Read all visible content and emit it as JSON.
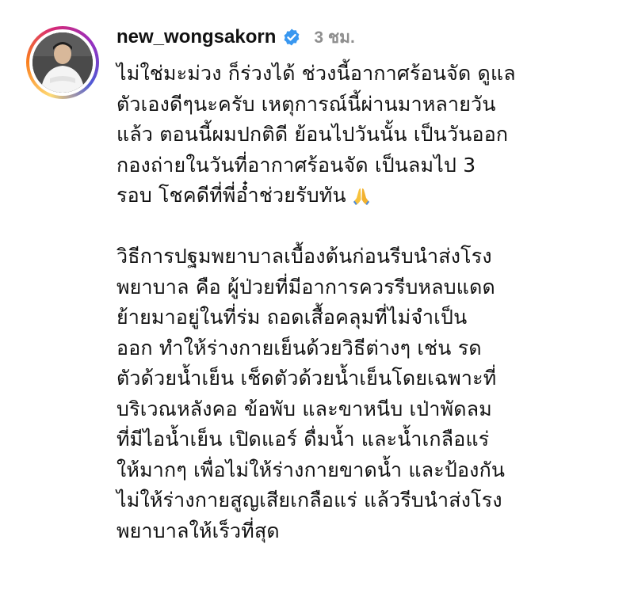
{
  "post": {
    "username": "new_wongsakorn",
    "time_ago": "3 ชม.",
    "avatar_icon": "profile-photo",
    "verified_icon": "verified-badge-icon",
    "paragraph1": [
      "ไม่ใช่มะม่วง ก็ร่วงได้ ช่วงนี้อากาศร้อนจัด ดูแล",
      "ตัวเองดีๆนะครับ เหตุการณ์นี้ผ่านมาหลายวัน",
      "แล้ว ตอนนี้ผมปกติดี ย้อนไปวันนั้น เป็นวันออก",
      "กองถ่ายในวันที่อากาศร้อนจัด เป็นลมไป 3",
      "รอบ โชคดีที่พี่อ๋ำช่วยรับทัน"
    ],
    "paragraph2": [
      "วิธีการปฐมพยาบาลเบื้องต้นก่อนรีบนำส่งโรง",
      "พยาบาล คือ ผู้ป่วยที่มีอาการควรรีบหลบแดด",
      "ย้ายมาอยู่ในที่ร่ม ถอดเสื้อคลุมที่ไม่จำเป็น",
      "ออก ทำให้ร่างกายเย็นด้วยวิธีต่างๆ เช่น รด",
      "ตัวด้วยน้ำเย็น เช็ดตัวด้วยน้ำเย็นโดยเฉพาะที่",
      "บริเวณหลังคอ ข้อพับ และขาหนีบ เป่าพัดลม",
      "ที่มีไอน้ำเย็น เปิดแอร์ ดื่มน้ำ และน้ำเกลือแร่",
      "ให้มากๆ เพื่อไม่ให้ร่างกายขาดน้ำ และป้องกัน",
      "ไม่ให้ร่างกายสูญเสียเกลือแร่ แล้วรีบนำส่งโรง",
      "พยาบาลให้เร็วที่สุด"
    ],
    "emoji": "folded-hands-icon"
  },
  "colors": {
    "verified": "#3897f0",
    "time": "#8e8e8e",
    "text": "#111111"
  }
}
